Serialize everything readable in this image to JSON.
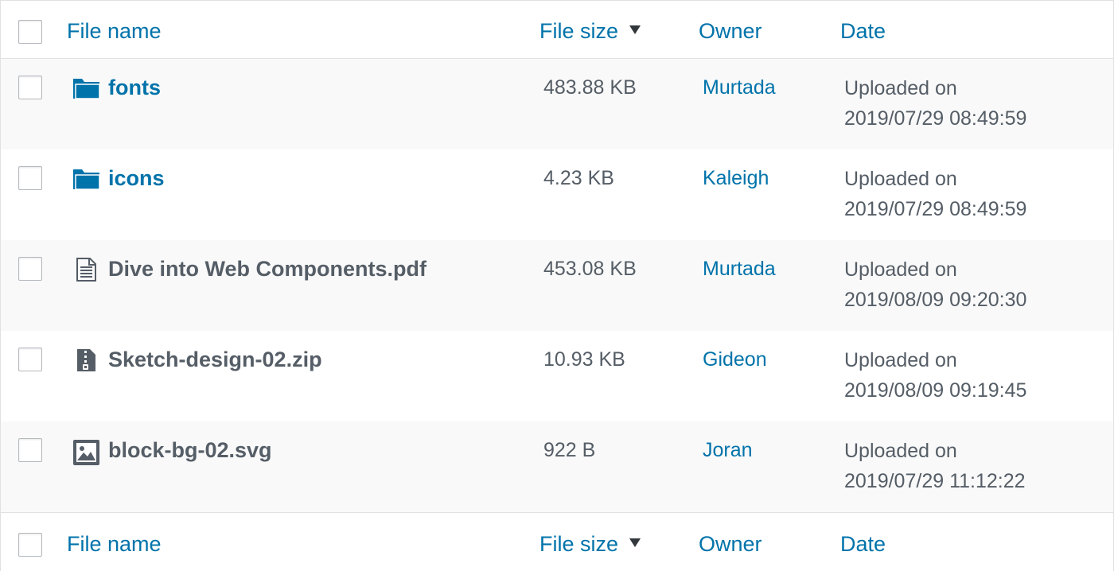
{
  "header": {
    "file_name": "File name",
    "file_size": "File size",
    "owner": "Owner",
    "date": "Date"
  },
  "footer": {
    "file_name": "File name",
    "file_size": "File size",
    "owner": "Owner",
    "date": "Date"
  },
  "rows": [
    {
      "type": "folder",
      "icon": "folder-icon",
      "name": "fonts",
      "size": "483.88 KB",
      "owner": "Murtada",
      "date_label": "Uploaded on",
      "date_value": "2019/07/29 08:49:59"
    },
    {
      "type": "folder",
      "icon": "folder-icon",
      "name": "icons",
      "size": "4.23 KB",
      "owner": "Kaleigh",
      "date_label": "Uploaded on",
      "date_value": "2019/07/29 08:49:59"
    },
    {
      "type": "file",
      "icon": "document-icon",
      "name": "Dive into Web Components.pdf",
      "size": "453.08 KB",
      "owner": "Murtada",
      "date_label": "Uploaded on",
      "date_value": "2019/08/09 09:20:30"
    },
    {
      "type": "file",
      "icon": "zip-icon",
      "name": "Sketch-design-02.zip",
      "size": "10.93 KB",
      "owner": "Gideon",
      "date_label": "Uploaded on",
      "date_value": "2019/08/09 09:19:45"
    },
    {
      "type": "file",
      "icon": "image-icon",
      "name": "block-bg-02.svg",
      "size": "922 B",
      "owner": "Joran",
      "date_label": "Uploaded on",
      "date_value": "2019/07/29 11:12:22"
    }
  ],
  "colors": {
    "link": "#0073aa",
    "text": "#555d66",
    "row_alt": "#f9f9f9",
    "border": "#e1e1e1"
  }
}
